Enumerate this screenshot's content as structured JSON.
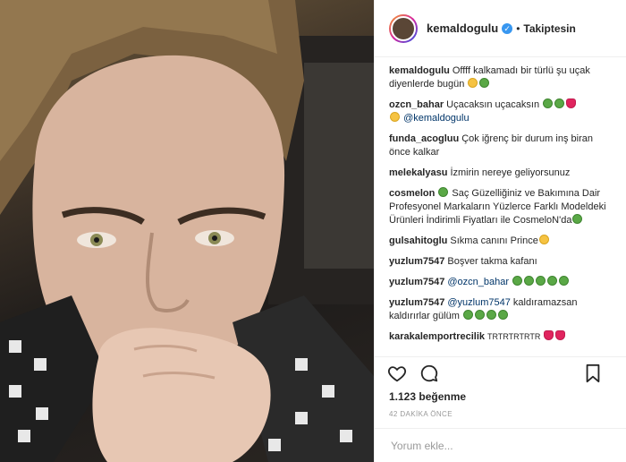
{
  "post": {
    "username": "kemaldogulu",
    "verified_icon": "verified-badge-icon",
    "follow_status": "Takiptesin",
    "separator": "•"
  },
  "comments": [
    {
      "user": "kemaldogulu",
      "text": "Offff kalkamadı bir türlü şu uçak diyenlerde bugün",
      "emoji": [
        "face",
        "green"
      ]
    },
    {
      "user": "ozcn_bahar",
      "text": "Uçacaksın uçacaksın",
      "emoji": [
        "green",
        "green",
        "heart"
      ],
      "text2": "",
      "mention": "@kemaldogulu"
    },
    {
      "user": "funda_acogluu",
      "text": "Çok iğrenç bir durum inş biran önce kalkar",
      "emoji": []
    },
    {
      "user": "melekalyasu",
      "text": "İzmirin nereye geliyorsunuz",
      "emoji": []
    },
    {
      "user": "cosmelon",
      "text": "Saç Güzelliğiniz ve Bakımına Dair Profesyonel Markaların Yüzlerce Farklı Modeldeki Ürünleri İndirimli Fiyatları ile CosmeloN'da",
      "emoji": [
        "green"
      ]
    },
    {
      "user": "gulsahitoglu",
      "text": "Sıkma canını Prince",
      "emoji": [
        "face"
      ]
    },
    {
      "user": "yuzlum7547",
      "text": "Boşver takma kafanı",
      "emoji": []
    },
    {
      "user": "yuzlum7547",
      "mention": "@ozcn_bahar",
      "text": "",
      "emoji": [
        "green",
        "green",
        "green",
        "green",
        "green"
      ]
    },
    {
      "user": "yuzlum7547",
      "mention": "@yuzlum7547",
      "text": "kaldıramazsan kaldırırlar gülüm",
      "emoji": [
        "green",
        "green",
        "green",
        "green"
      ]
    },
    {
      "user": "karakalemportrecilik",
      "text": "TRTRTRTRTR",
      "emoji": [
        "heart",
        "heart"
      ]
    }
  ],
  "actions": {
    "like_icon": "heart-icon",
    "comment_icon": "comment-bubble-icon",
    "save_icon": "bookmark-icon"
  },
  "likes": "1.123 beğenme",
  "time_ago": "42 DAKİKA ÖNCE",
  "add_comment_placeholder": "Yorum ekle...",
  "colors": {
    "verified": "#3897f0",
    "mention": "#003569",
    "meta_text": "#999999",
    "border": "#efefef"
  }
}
